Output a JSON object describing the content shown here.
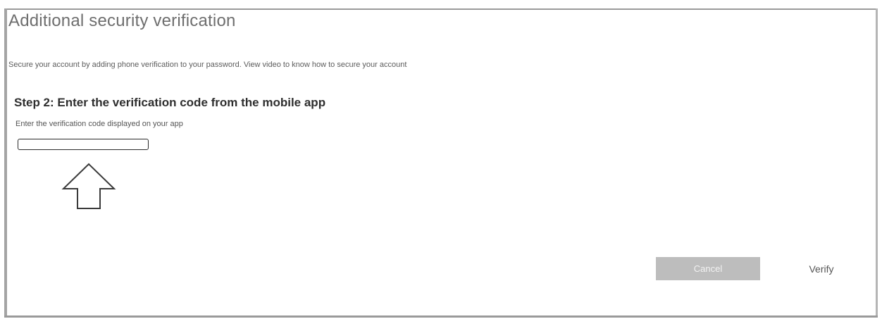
{
  "dialog": {
    "title": "Additional security verification",
    "intro_text": "Secure your account by adding phone verification to your password. View video to know how to secure your account"
  },
  "step": {
    "heading": "Step 2: Enter the verification code from the mobile app",
    "hint": "Enter the verification code displayed on your app",
    "code_value": ""
  },
  "annotation": {
    "icon": "up-arrow-outline-icon"
  },
  "actions": {
    "cancel_label": "Cancel",
    "verify_label": "Verify"
  },
  "colors": {
    "cancel_background": "#bdbdbd",
    "frame": "#9a9a9a"
  }
}
